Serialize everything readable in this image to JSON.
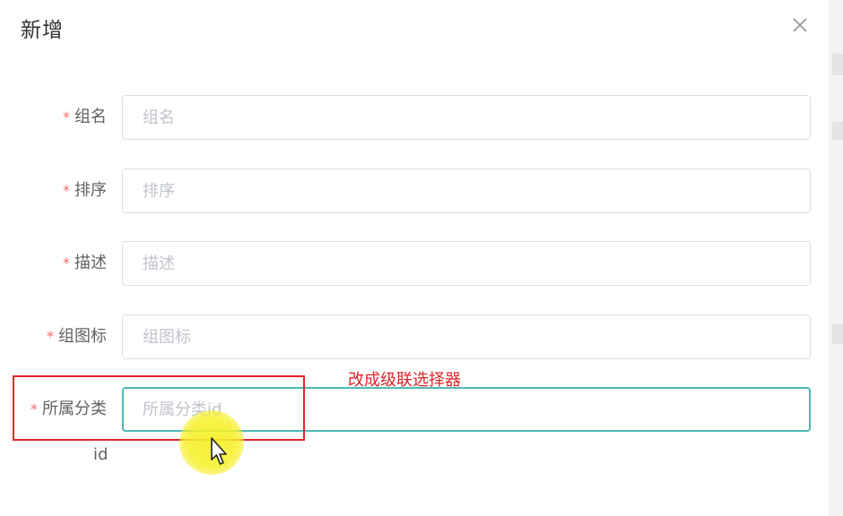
{
  "dialog": {
    "title": "新增",
    "close_icon": "close-icon"
  },
  "form": {
    "fields": [
      {
        "label": "组名",
        "placeholder": "组名",
        "required": true
      },
      {
        "label": "排序",
        "placeholder": "排序",
        "required": true
      },
      {
        "label": "描述",
        "placeholder": "描述",
        "required": true
      },
      {
        "label": "组图标",
        "placeholder": "组图标",
        "required": true
      },
      {
        "label": "所属分类",
        "placeholder": "所属分类id",
        "required": true,
        "focused": true
      }
    ],
    "required_mark": "*",
    "sub_label": "id"
  },
  "annotation": {
    "note": "改成级联选择器",
    "color": "#e0252a"
  },
  "colors": {
    "focus_border": "#4fbab7",
    "required": "#f56c6c",
    "cursor_highlight": "#f6f028"
  }
}
